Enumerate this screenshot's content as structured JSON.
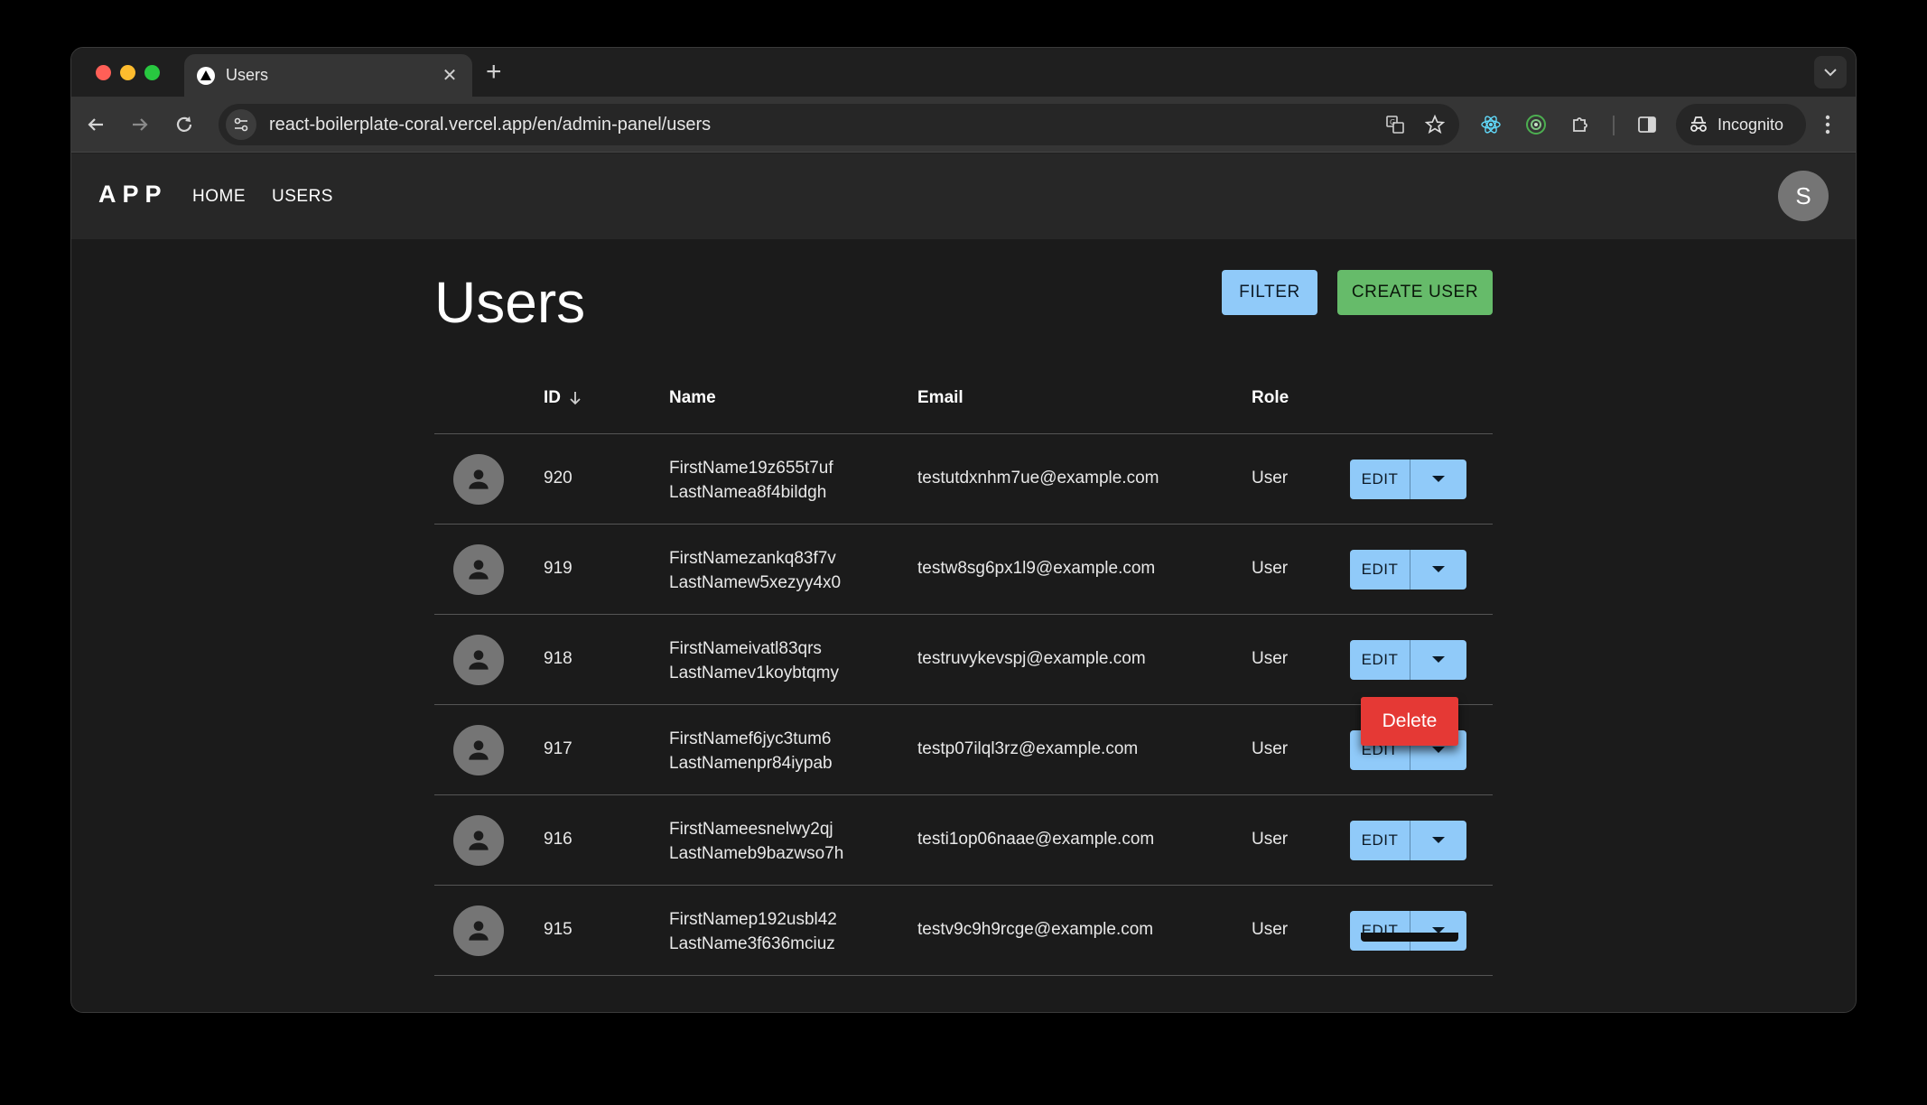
{
  "browser": {
    "tab_title": "Users",
    "new_tab": "+",
    "url": "react-boilerplate-coral.vercel.app/en/admin-panel/users",
    "incognito_label": "Incognito"
  },
  "app": {
    "logo": "APP",
    "nav": [
      "HOME",
      "USERS"
    ],
    "avatar_initial": "S"
  },
  "page": {
    "title": "Users",
    "filter_label": "FILTER",
    "create_label": "CREATE USER"
  },
  "table": {
    "headers": {
      "id": "ID",
      "name": "Name",
      "email": "Email",
      "role": "Role"
    },
    "edit_label": "EDIT",
    "rows": [
      {
        "id": "920",
        "first": "FirstName19z655t7uf",
        "last": "LastNamea8f4bildgh",
        "email": "testutdxnhm7ue@example.com",
        "role": "User"
      },
      {
        "id": "919",
        "first": "FirstNamezankq83f7v",
        "last": "LastNamew5xezyy4x0",
        "email": "testw8sg6px1l9@example.com",
        "role": "User"
      },
      {
        "id": "918",
        "first": "FirstNameivatl83qrs",
        "last": "LastNamev1koybtqmy",
        "email": "testruvykevspj@example.com",
        "role": "User"
      },
      {
        "id": "917",
        "first": "FirstNamef6jyc3tum6",
        "last": "LastNamenpr84iypab",
        "email": "testp07ilql3rz@example.com",
        "role": "User"
      },
      {
        "id": "916",
        "first": "FirstNameesnelwy2qj",
        "last": "LastNameb9bazwso7h",
        "email": "testi1op06naae@example.com",
        "role": "User"
      },
      {
        "id": "915",
        "first": "FirstNamep192usbl42",
        "last": "LastName3f636mciuz",
        "email": "testv9c9h9rcge@example.com",
        "role": "User"
      }
    ]
  },
  "popup": {
    "delete_label": "Delete"
  },
  "colors": {
    "primary": "#90caf9",
    "success": "#66bb6a",
    "danger": "#e53935",
    "avatar": "#757575"
  }
}
